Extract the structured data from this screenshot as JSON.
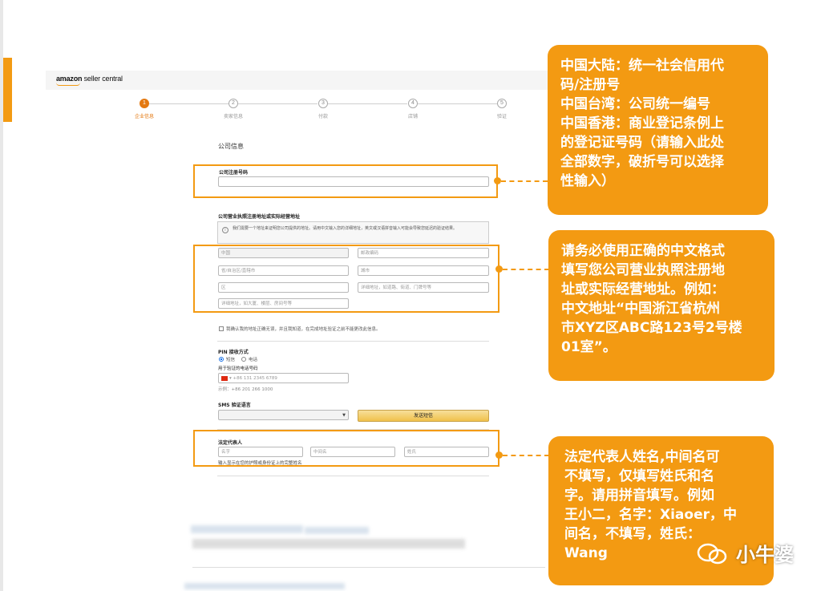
{
  "header": {
    "logo_brand": "amazon",
    "logo_product": "seller central"
  },
  "progress": {
    "steps": [
      {
        "num": "1",
        "label": "企业信息"
      },
      {
        "num": "2",
        "label": "卖家信息"
      },
      {
        "num": "3",
        "label": "付款"
      },
      {
        "num": "4",
        "label": "店铺"
      },
      {
        "num": "5",
        "label": "验证"
      }
    ]
  },
  "form": {
    "heading": "公司信息",
    "reg_number_label": "公司注册号码",
    "address_label": "公司营业执照注册地址或实际经营地址",
    "info_text": "我们需要一个地址来证明您公司提供的地址。请用中文输入您的详细地址，英文或汉语拼音输入可能会导致您延迟的验证结果。",
    "country_placeholder": "中国",
    "postcode_placeholder": "邮政编码",
    "province_placeholder": "省/自治区/直辖市",
    "city_placeholder": "城市",
    "district_placeholder": "区",
    "address1_placeholder": "详细地址，如道路、街道、门牌号等",
    "address2_placeholder": "详细地址，如大厦、楼层、房间号等",
    "confirm_text": "我确认我的地址正确无误，并且我知道，在完成地址验证之前不能更改此信息。",
    "pin_label": "PIN 接收方式",
    "pin_option_sms": "短信",
    "pin_option_call": "电话",
    "phone_label": "用于验证的电话号码",
    "phone_value": "+86 131 2345 6789",
    "phone_example": "示例：+86 201 266 1000",
    "sms_lang_label": "SMS 验证语言",
    "send_button": "发送短信",
    "legal_rep_label": "法定代表人",
    "first_name_placeholder": "名字",
    "middle_name_placeholder": "中间名",
    "last_name_placeholder": "姓氏",
    "legal_rep_note": "输入显示在您的护照或身份证上的完整姓名"
  },
  "callouts": {
    "one": [
      "中国大陆：统一社会信用代",
      "码/注册号",
      "中国台湾：公司统一编号",
      "中国香港：商业登记条例上",
      "的登记证号码（请输入此处",
      "全部数字，破折号可以选择",
      "性输入）"
    ],
    "two": [
      "请务必使用正确的中文格式",
      "填写您公司营业执照注册地",
      "址或实际经营地址。例如：",
      "中文地址“中国浙江省杭州",
      "市XYZ区ABC路123号2号楼",
      "01室”。"
    ],
    "three": [
      "法定代表人姓名,中间名可",
      "不填写，仅填写姓氏和名",
      "字。请用拼音填写。例如",
      "王小二，名字：Xiaoer，中",
      "间名，不填写，姓氏：",
      "Wang"
    ]
  },
  "watermark": "小牛婆",
  "colors": {
    "accent": "#f39a12",
    "amazon_orange": "#e47911",
    "button": "#f0c14b"
  }
}
